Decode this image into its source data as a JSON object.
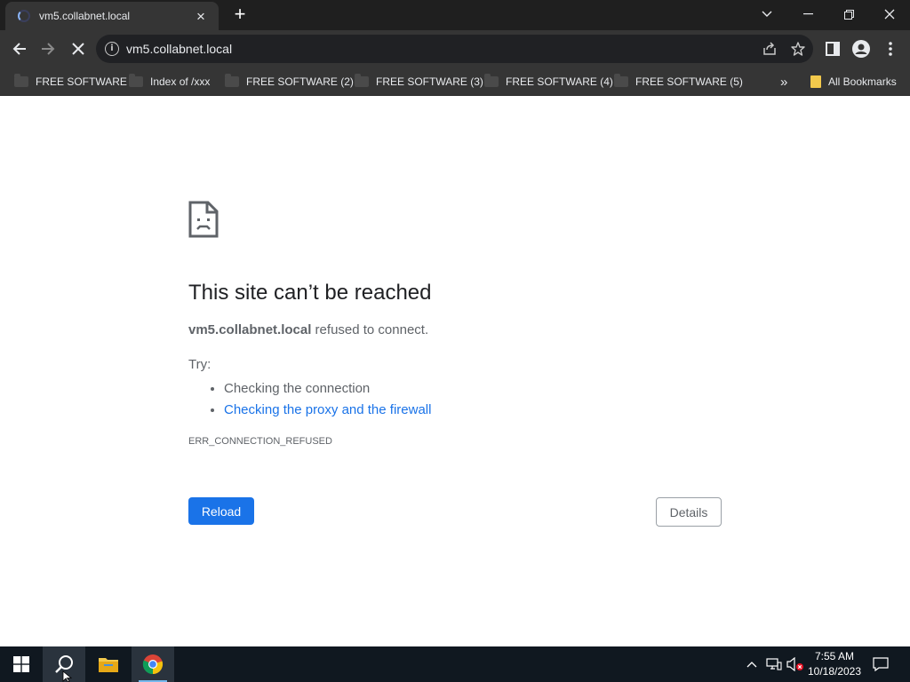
{
  "browser": {
    "tab_title": "vm5.collabnet.local",
    "address": "vm5.collabnet.local",
    "bookmarks": [
      {
        "label": "FREE SOFTWARE"
      },
      {
        "label": "Index of /xxx"
      },
      {
        "label": "FREE SOFTWARE (2)"
      },
      {
        "label": "FREE SOFTWARE (3)"
      },
      {
        "label": "FREE SOFTWARE (4)"
      },
      {
        "label": "FREE SOFTWARE (5)"
      }
    ],
    "all_bookmarks": "All Bookmarks"
  },
  "error_page": {
    "title": "This site can’t be reached",
    "host": "vm5.collabnet.local",
    "summary_rest": " refused to connect.",
    "try_label": "Try:",
    "suggestions": [
      "Checking the connection",
      "Checking the proxy and the firewall"
    ],
    "error_code": "ERR_CONNECTION_REFUSED",
    "reload_label": "Reload",
    "details_label": "Details"
  },
  "taskbar": {
    "time": "7:55 AM",
    "date": "10/18/2023"
  },
  "colors": {
    "accent": "#1a73e8",
    "chrome_dark": "#353535",
    "tab_strip": "#1f1f1f",
    "taskbar": "#101820"
  }
}
